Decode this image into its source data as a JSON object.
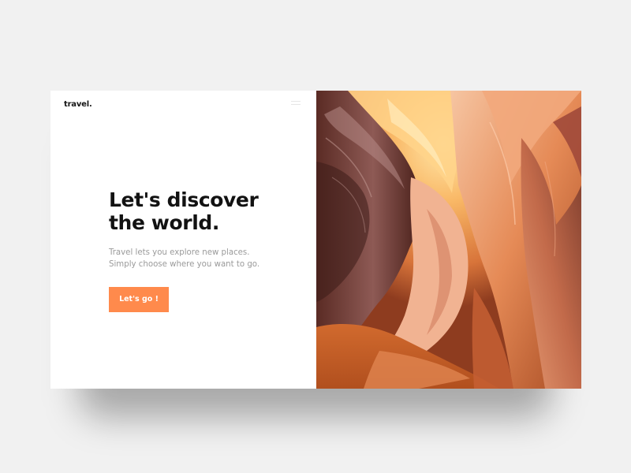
{
  "brand": {
    "logo": "travel."
  },
  "hero": {
    "headline_line1": "Let's discover",
    "headline_line2": "the world.",
    "subtitle_line1": "Travel lets you explore new places.",
    "subtitle_line2": "Simply choose where you want to go.",
    "cta_label": "Let's go !"
  },
  "icons": {
    "menu": "menu-icon"
  },
  "colors": {
    "accent": "#ff8a4c",
    "headline": "#121212",
    "subtitle": "#9a9a9a",
    "background": "#f1f1f1"
  }
}
